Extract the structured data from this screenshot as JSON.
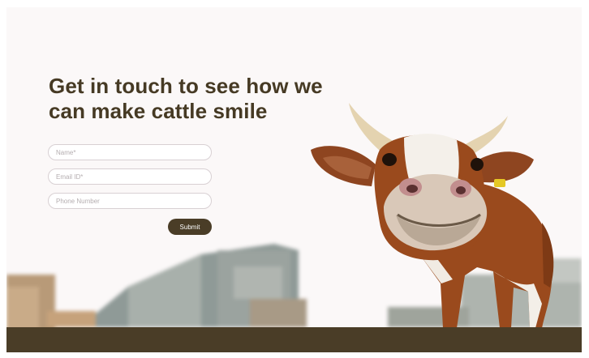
{
  "hero": {
    "headline": "Get in touch to see how we can make cattle smile"
  },
  "form": {
    "name_placeholder": "Name*",
    "email_placeholder": "Email ID*",
    "phone_placeholder": "Phone Number",
    "submit_label": "Submit"
  },
  "colors": {
    "brand_brown": "#4a3d27",
    "headline": "#463a24",
    "page_bg": "#fbf8f8"
  }
}
